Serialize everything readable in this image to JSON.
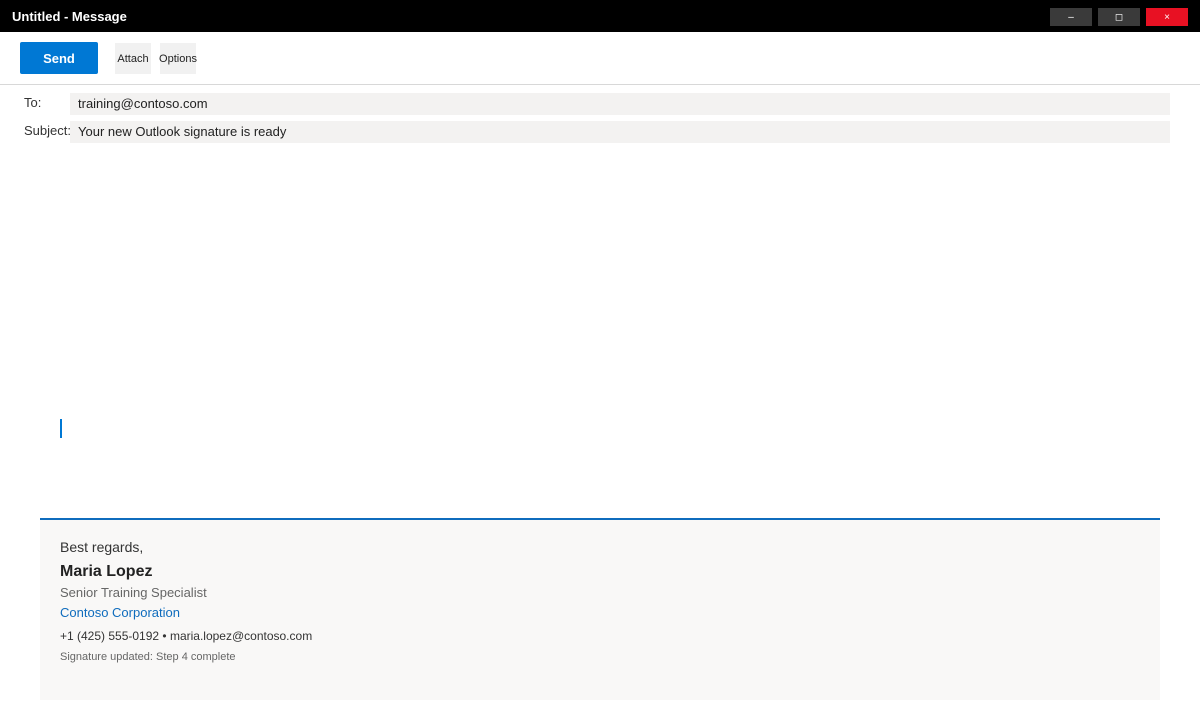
{
  "window": {
    "title": "Untitled - Message",
    "minimize_glyph": "–",
    "maximize_glyph": "◻",
    "close_glyph": "×",
    "close_color": "#e81123"
  },
  "toolbar": {
    "send_label": "Send",
    "attach_label": "Attach",
    "options_label": "Options",
    "accent_color": "#0078d4"
  },
  "compose": {
    "to_label": "To:",
    "to_value": "training@contoso.com",
    "subject_label": "Subject:",
    "subject_value": "Your new Outlook signature is ready"
  },
  "signature": {
    "greeting": "Best regards,",
    "name": "Maria Lopez",
    "role": "Senior Training Specialist",
    "company": "Contoso Corporation",
    "contact": "+1 (425) 555-0192 • maria.lopez@contoso.com",
    "status": "Signature updated: Step 4 complete"
  }
}
